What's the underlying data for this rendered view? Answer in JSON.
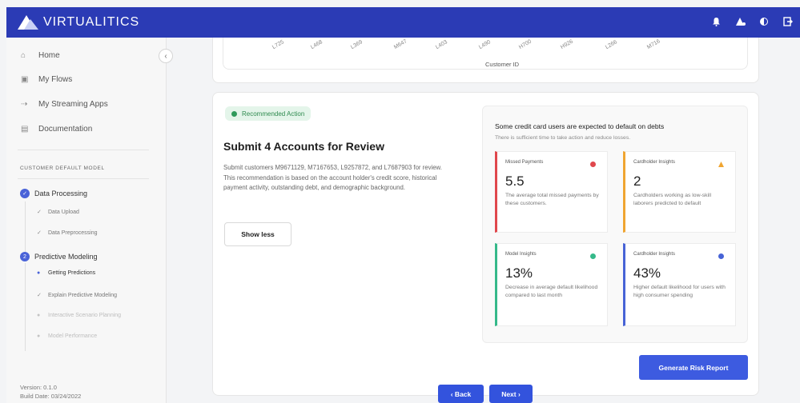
{
  "topbar": {
    "brand": "VIRTUALITICS",
    "icons": [
      "bell-icon",
      "user-alert-icon",
      "theme-toggle-icon",
      "logout-icon"
    ],
    "color": "#2b3bb5"
  },
  "sidebar": {
    "nav": [
      {
        "label": "Home",
        "icon": "home-icon"
      },
      {
        "label": "My Flows",
        "icon": "flows-icon"
      },
      {
        "label": "My Streaming Apps",
        "icon": "streaming-icon"
      },
      {
        "label": "Documentation",
        "icon": "document-icon"
      }
    ],
    "section_title": "CUSTOMER DEFAULT MODEL",
    "steps": [
      {
        "label": "Data Processing",
        "marker": "✓"
      },
      {
        "label": "Predictive Modeling",
        "marker": "2"
      }
    ],
    "substeps": [
      {
        "label": "Data Upload",
        "mark": "✓"
      },
      {
        "label": "Data Preprocessing",
        "mark": "✓"
      },
      {
        "label": "Getting Predictions",
        "mark": "●"
      },
      {
        "label": "Explain Predictive Modeling",
        "mark": "✓"
      },
      {
        "label": "Interactive Scenario Planning",
        "mark": "●"
      },
      {
        "label": "Model Performance",
        "mark": "●"
      }
    ],
    "version": "Version: 0.1.0",
    "build_date": "Build Date: 03/24/2022"
  },
  "chart": {
    "xlabel": "Customer ID",
    "ticks": [
      "L725",
      "L468",
      "L369",
      "M647",
      "L403",
      "L490",
      "H700",
      "H926",
      "L266",
      "M716"
    ]
  },
  "main": {
    "badge": "Recommended Action",
    "title": "Submit 4 Accounts for Review",
    "description": "Submit customers M9671129, M7167653, L9257872, and L7687903 for review. This recommendation is based on the account holder's credit score, historical payment activity, outstanding debt, and demographic background.",
    "show_less": "Show less",
    "insights_heading": "Some credit card users are expected to default on debts",
    "insights_sub": "There is sufficient time to take action and reduce losses.",
    "cards": [
      {
        "label": "Missed Payments",
        "value": "5.5",
        "desc": "The average total missed payments by these customers.",
        "color": "#e0474c",
        "indicator": "circle"
      },
      {
        "label": "Cardholder Insights",
        "value": "2",
        "desc": "Cardholders working as low-skill laborers predicted to default",
        "color": "#f0a531",
        "indicator": "triangle"
      },
      {
        "label": "Model Insights",
        "value": "13%",
        "desc": "Decrease in average default likelihood compared to last month",
        "color": "#35b98a",
        "indicator": "circle"
      },
      {
        "label": "Cardholder Insights",
        "value": "43%",
        "desc": "Higher default likelihood for users with high consumer spending",
        "color": "#4763d6",
        "indicator": "circle"
      }
    ],
    "generate_button": "Generate Risk Report"
  },
  "footer": {
    "back": "‹  Back",
    "next": "Next  ›"
  }
}
